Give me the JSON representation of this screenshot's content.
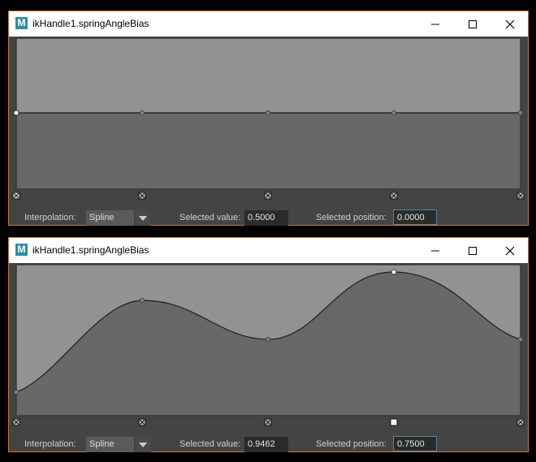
{
  "windows": [
    {
      "title": "ikHandle1.springAngleBias",
      "app_icon": "M",
      "interpolation_label": "Interpolation:",
      "interpolation_value": "Spline",
      "selected_value_label": "Selected value:",
      "selected_value": "0.5000",
      "selected_position_label": "Selected position:",
      "selected_position": "0.0000",
      "curve_keys": [
        [
          0,
          0.5
        ],
        [
          0.25,
          0.5
        ],
        [
          0.5,
          0.5
        ],
        [
          0.75,
          0.5
        ],
        [
          1,
          0.5
        ]
      ],
      "selected_key": 0
    },
    {
      "title": "ikHandle1.springAngleBias",
      "app_icon": "M",
      "interpolation_label": "Interpolation:",
      "interpolation_value": "Spline",
      "selected_value_label": "Selected value:",
      "selected_value": "0.9462",
      "selected_position_label": "Selected position:",
      "selected_position": "0.7500",
      "curve_keys": [
        [
          0,
          0.15
        ],
        [
          0.25,
          0.7
        ],
        [
          0.5,
          0.5
        ],
        [
          0.75,
          0.95
        ],
        [
          1,
          0.5
        ]
      ],
      "selected_key": 3
    }
  ],
  "colors": {
    "above_curve": "#929292",
    "below_curve": "#686868",
    "frame_border": "#c9773a",
    "key_point": "#4a6a8a"
  },
  "icons": [
    "maya-app-icon",
    "minimize-icon",
    "maximize-icon",
    "close-icon",
    "key-handle-icon"
  ]
}
